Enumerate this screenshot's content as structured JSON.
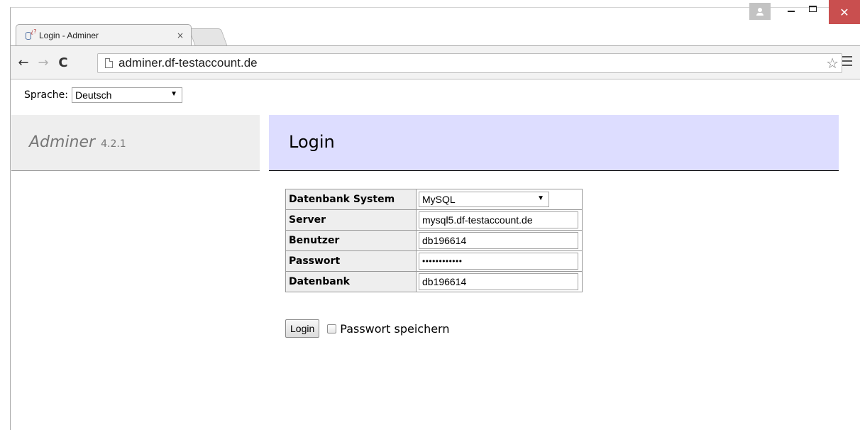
{
  "browser": {
    "tab_title": "Login - Adminer",
    "tab_close": "×",
    "url": "adminer.df-testaccount.de",
    "nav": {
      "back": "←",
      "forward": "→",
      "reload": "C"
    },
    "star": "☆",
    "close_glyph": "✕"
  },
  "page": {
    "language": {
      "label": "Sprache:",
      "selected": "Deutsch"
    },
    "brand": {
      "name": "Adminer",
      "version": "4.2.1"
    },
    "heading": "Login",
    "form": {
      "rows": [
        {
          "label": "Datenbank System",
          "type": "select",
          "value": "MySQL"
        },
        {
          "label": "Server",
          "type": "text",
          "value": "mysql5.df-testaccount.de"
        },
        {
          "label": "Benutzer",
          "type": "text",
          "value": "db196614"
        },
        {
          "label": "Passwort",
          "type": "password",
          "value": "••••••••••••"
        },
        {
          "label": "Datenbank",
          "type": "text",
          "value": "db196614"
        }
      ],
      "submit_label": "Login",
      "remember_label": "Passwort speichern"
    }
  },
  "colors": {
    "header_bg": "#ddddff",
    "menu_bg": "#eeeeee",
    "close_button": "#c94f4f"
  }
}
